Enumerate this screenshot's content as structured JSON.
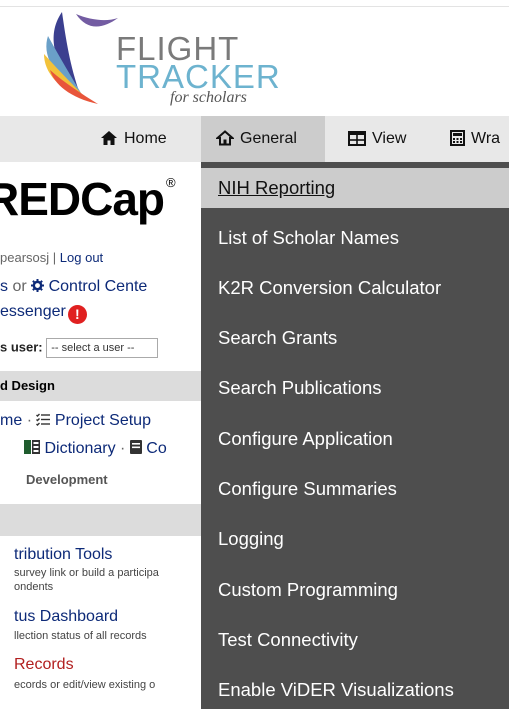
{
  "logo": {
    "line1": "FLIGHT",
    "line2": "TRACKER",
    "line3": "for scholars"
  },
  "nav": {
    "home": "Home",
    "general": "General",
    "view": "View",
    "wrangle": "Wra"
  },
  "menu": {
    "items": [
      "NIH Reporting",
      "List of Scholar Names",
      "K2R Conversion Calculator",
      "Search Grants",
      "Search Publications",
      "Configure Application",
      "Configure Summaries",
      "Logging",
      "Custom Programming",
      "Test Connectivity",
      "Enable ViDER Visualizations"
    ],
    "active_index": 0
  },
  "redcap_page": {
    "brand": "REDCap",
    "brand_mark": "®",
    "user": "pearsosj",
    "separator": "|",
    "logout": "Log out",
    "projects_fragment": "s",
    "or": "or",
    "control_center": "Control Cente",
    "messenger": "essenger",
    "alert_glyph": "!",
    "as_user_label": "s user:",
    "select_user": "-- select a user --",
    "design_header": "d Design",
    "home_fragment": "me",
    "dot": "·",
    "project_setup": "Project Setup",
    "dictionary": "Dictionary",
    "codebook_fragment": "Co",
    "status": "Development",
    "distribution_tools": "tribution Tools",
    "distribution_desc_1": "survey link or build a participa",
    "distribution_desc_2": "ondents",
    "status_dashboard": "tus Dashboard",
    "status_dashboard_desc": "llection status of all records",
    "records": "Records",
    "records_desc": "ecords or edit/view existing o"
  },
  "colors": {
    "menu_bg": "#4e4e4e",
    "menu_active_bg": "#cccccc",
    "nav_bg": "#e8e8e8",
    "link_blue": "#0d2a78",
    "records_red": "#b21f1f"
  }
}
